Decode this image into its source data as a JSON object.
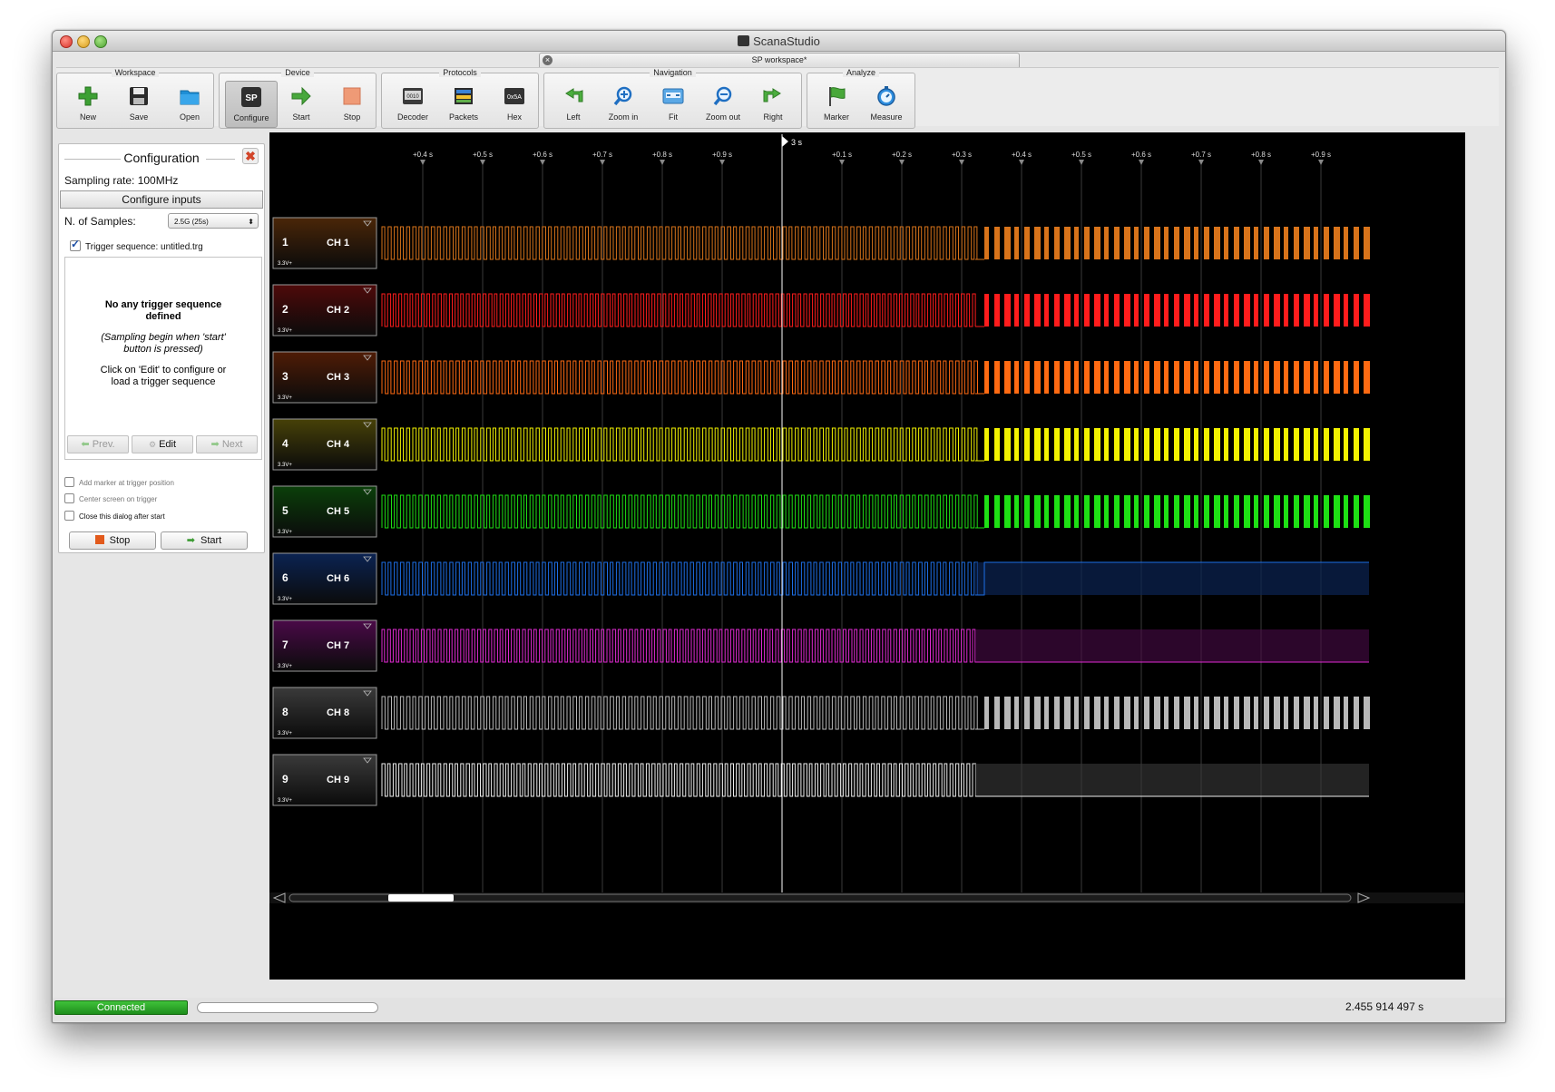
{
  "window": {
    "title": "ScanaStudio"
  },
  "tab": {
    "label": "SP workspace*"
  },
  "toolbar": {
    "groups": [
      {
        "label": "Workspace",
        "buttons": [
          "New",
          "Save",
          "Open"
        ]
      },
      {
        "label": "Device",
        "buttons": [
          "Configure",
          "Start",
          "Stop"
        ]
      },
      {
        "label": "Protocols",
        "buttons": [
          "Decoder",
          "Packets",
          "Hex"
        ]
      },
      {
        "label": "Navigation",
        "buttons": [
          "Left",
          "Zoom in",
          "Fit",
          "Zoom out",
          "Right"
        ]
      },
      {
        "label": "Analyze",
        "buttons": [
          "Marker",
          "Measure"
        ]
      }
    ],
    "configure_icon_text": "SP",
    "decoder_icon_text": "0010",
    "hex_icon_text": "0x5A"
  },
  "config": {
    "title": "Configuration",
    "sampling_rate": "Sampling rate: 100MHz",
    "configure_inputs": "Configure inputs",
    "n_samples_label": "N. of Samples:",
    "n_samples_value": "2.5G (25s)",
    "trigger_label": "Trigger sequence: untitled.trg",
    "trigger_checked": true,
    "msg_no_trigger": "No any trigger sequence defined",
    "msg_sampling": "(Sampling begin when 'start' button is pressed)",
    "msg_click": "Click on 'Edit' to configure or load a trigger sequence",
    "prev": "Prev.",
    "edit": "Edit",
    "next": "Next",
    "options": [
      "Add marker at trigger position",
      "Center screen on trigger",
      "Close this dialog after start"
    ],
    "stop": "Stop",
    "start": "Start"
  },
  "timeline": {
    "cursor_label": "3 s",
    "ticks_left": [
      "+0.4 s",
      "+0.5 s",
      "+0.6 s",
      "+0.7 s",
      "+0.8 s",
      "+0.9 s"
    ],
    "ticks_right": [
      "+0.1 s",
      "+0.2 s",
      "+0.3 s",
      "+0.4 s",
      "+0.5 s",
      "+0.6 s",
      "+0.7 s",
      "+0.8 s",
      "+0.9 s"
    ]
  },
  "channels": [
    {
      "num": "1",
      "name": "CH 1",
      "voltage": "3.3V+",
      "color": "#d8731a",
      "bg": "#4a2608",
      "after": "pulses"
    },
    {
      "num": "2",
      "name": "CH 2",
      "voltage": "3.3V+",
      "color": "#ff1c1c",
      "bg": "#4e0a0a",
      "after": "pulses"
    },
    {
      "num": "3",
      "name": "CH 3",
      "voltage": "3.3V+",
      "color": "#ff6a12",
      "bg": "#4f1c06",
      "after": "pulses"
    },
    {
      "num": "4",
      "name": "CH 4",
      "voltage": "3.3V+",
      "color": "#f2f200",
      "bg": "#474108",
      "after": "pulses"
    },
    {
      "num": "5",
      "name": "CH 5",
      "voltage": "3.3V+",
      "color": "#1ee014",
      "bg": "#0b3f0a",
      "after": "pulses"
    },
    {
      "num": "6",
      "name": "CH 6",
      "voltage": "3.3V+",
      "color": "#1d6ee6",
      "bg": "#0b2352",
      "after": "high"
    },
    {
      "num": "7",
      "name": "CH 7",
      "voltage": "3.3V+",
      "color": "#e02ad2",
      "bg": "#4a0a48",
      "after": "low"
    },
    {
      "num": "8",
      "name": "CH 8",
      "voltage": "3.3V+",
      "color": "#b8b8b8",
      "bg": "#3a3a3a",
      "after": "pulses"
    },
    {
      "num": "9",
      "name": "CH 9",
      "voltage": "3.3V+",
      "color": "#eeeeee",
      "bg": "#3a3a3a",
      "after": "low"
    }
  ],
  "status": {
    "connected": "Connected",
    "time": "2.455 914 497 s"
  }
}
